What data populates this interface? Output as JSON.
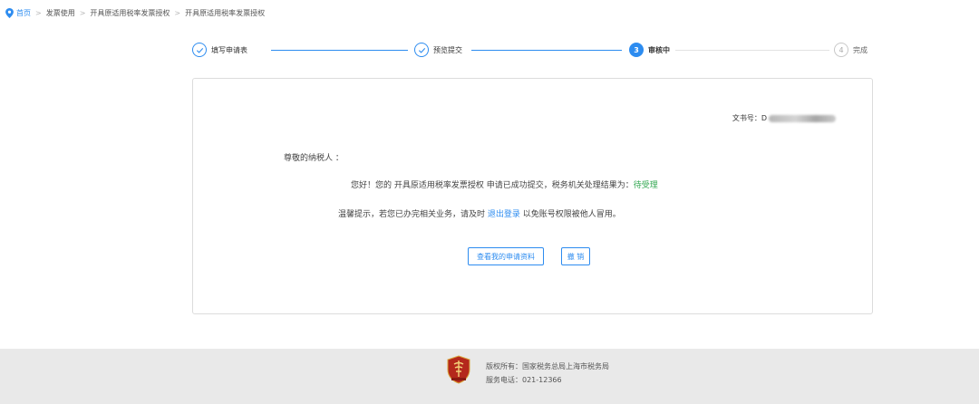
{
  "breadcrumb": {
    "items": [
      "首页",
      "发票使用",
      "开具原适用税率发票授权",
      "开具原适用税率发票授权"
    ]
  },
  "steps": [
    {
      "num": "",
      "label": "填写申请表",
      "state": "done"
    },
    {
      "num": "",
      "label": "预览提交",
      "state": "done"
    },
    {
      "num": "3",
      "label": "审核中",
      "state": "active"
    },
    {
      "num": "4",
      "label": "完成",
      "state": "todo"
    }
  ],
  "card": {
    "doc_no_label": "文书号：D",
    "greeting": "尊敬的纳税人 ：",
    "msg1_prefix": "您好！您的 开具原适用税率发票授权 申请已成功提交，税务机关处理结果为：",
    "msg1_status": "待受理",
    "msg2_prefix": "温馨提示，若您已办完相关业务，请及时 ",
    "msg2_link": "退出登录",
    "msg2_suffix": " 以免账号权限被他人冒用。",
    "view_button": "查看我的申请资料",
    "cancel_button": "撤 销"
  },
  "footer": {
    "copyright": "版权所有：国家税务总局上海市税务局",
    "phone": "服务电话：021-12366"
  },
  "colors": {
    "accent": "#2d8cf0",
    "status_green": "#34a853",
    "footer_bg": "#e9e9e9",
    "logo_red": "#b4281c"
  }
}
